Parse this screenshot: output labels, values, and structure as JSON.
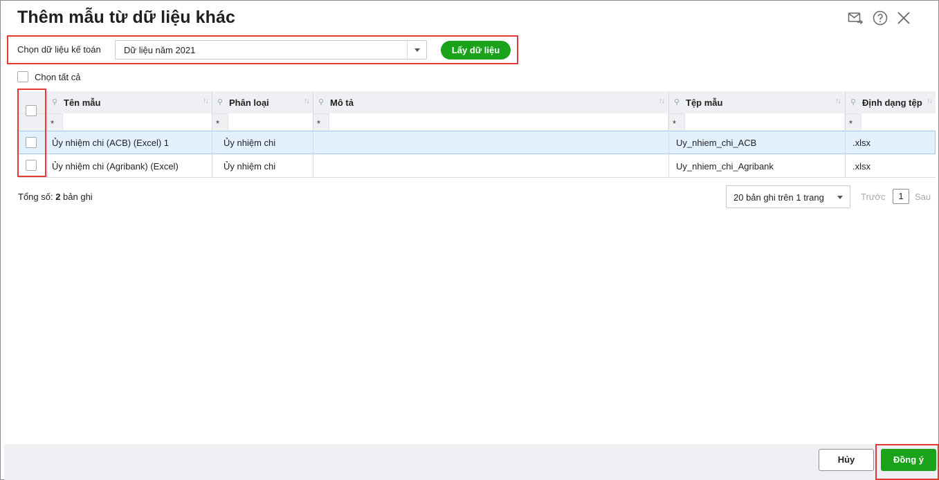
{
  "dialog": {
    "title": "Thêm mẫu từ dữ liệu khác",
    "icons": [
      "email-forward-icon",
      "help-icon",
      "close-icon"
    ]
  },
  "source": {
    "label": "Chọn dữ liệu kế toán",
    "selected": "Dữ liệu năm 2021",
    "get_button": "Lấy dữ liệu"
  },
  "select_all": {
    "label": "Chọn tất cả",
    "checked": false
  },
  "table": {
    "columns": [
      {
        "label": "Tên mẫu"
      },
      {
        "label": "Phân loại"
      },
      {
        "label": "Mô tả"
      },
      {
        "label": "Tệp mẫu"
      },
      {
        "label": "Định dạng tệp"
      }
    ],
    "filter_symbol": "*",
    "rows": [
      {
        "name": "Ủy nhiệm chi (ACB) (Excel) 1",
        "category": "Ủy nhiệm chi",
        "description": "",
        "file": "Uy_nhiem_chi_ACB",
        "format": ".xlsx",
        "checked": false,
        "selected": true
      },
      {
        "name": "Ủy nhiệm chi (Agribank) (Excel)",
        "category": "Ủy nhiệm chi",
        "description": "",
        "file": "Uy_nhiem_chi_Agribank",
        "format": ".xlsx",
        "checked": false,
        "selected": false
      }
    ]
  },
  "summary": {
    "prefix": "Tổng số: ",
    "count": "2",
    "suffix": " bản ghi"
  },
  "pager": {
    "page_size": "20 bản ghi trên 1 trang",
    "prev": "Trước",
    "current": "1",
    "next": "Sau"
  },
  "footer": {
    "cancel": "Hủy",
    "ok": "Đồng ý"
  },
  "colors": {
    "accent_green": "#1aa31a",
    "highlight_red": "#e53935",
    "selected_row": "#e3f0fd",
    "header_bg": "#eef0f4"
  }
}
